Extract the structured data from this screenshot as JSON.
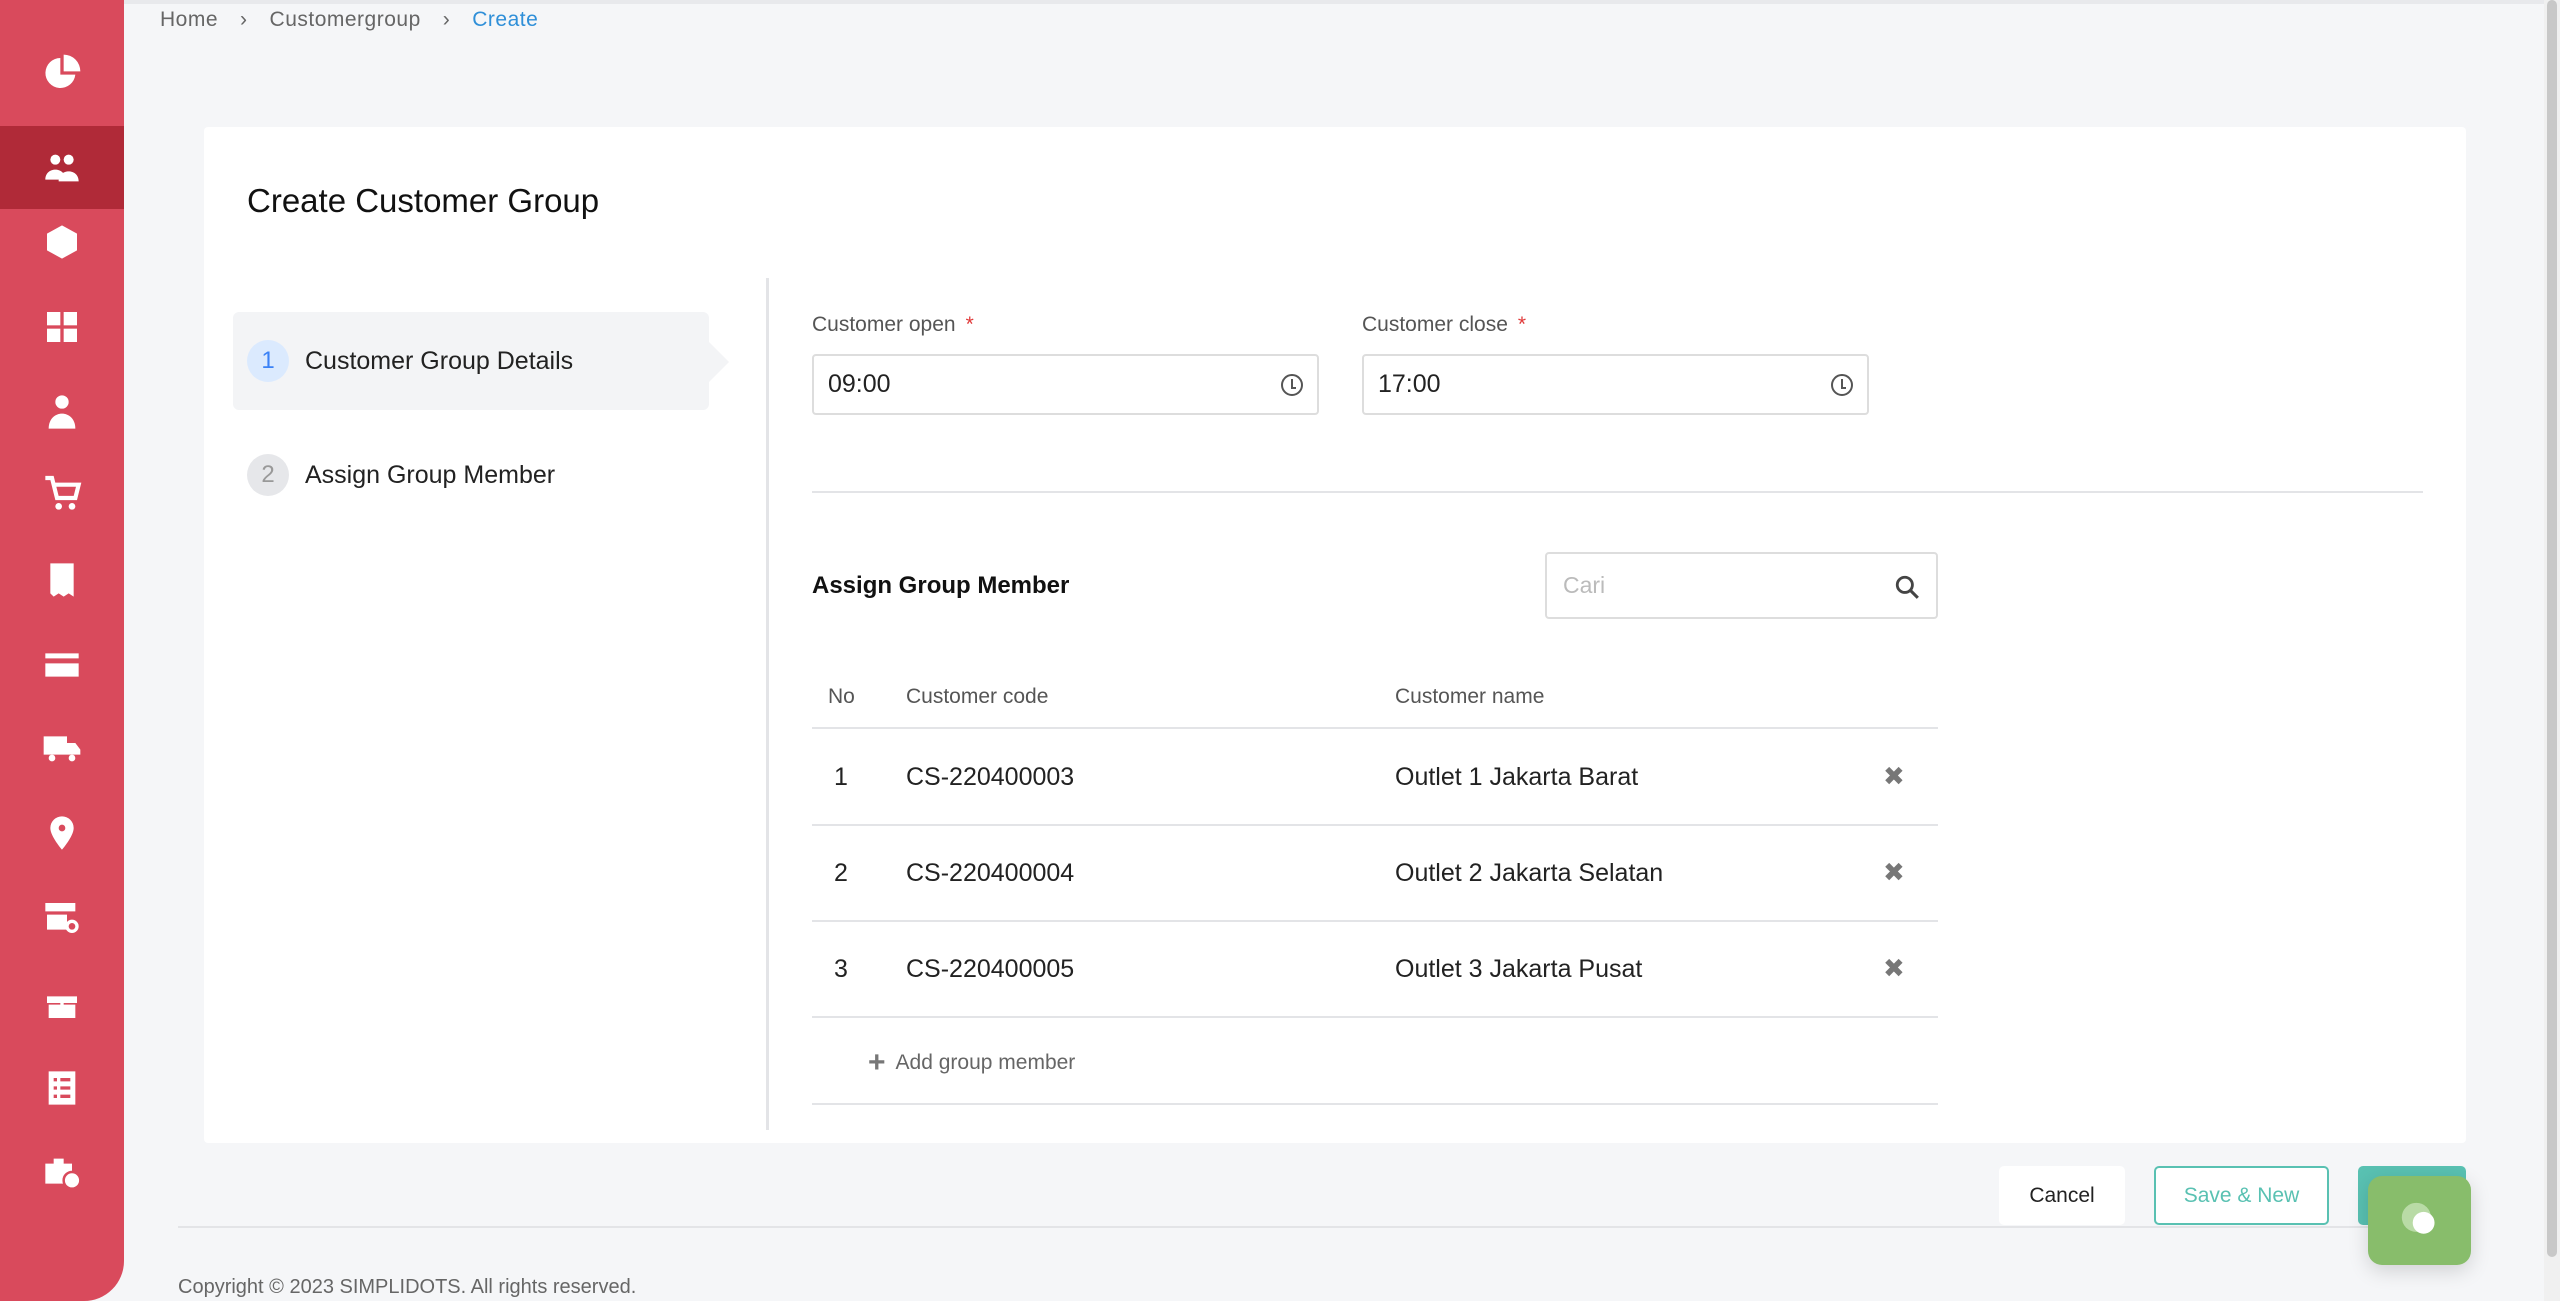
{
  "sidebar": {
    "accent": "#d94a5c",
    "active_color": "#b02a38",
    "items": [
      {
        "icon": "pie-chart-icon"
      },
      {
        "icon": "users-icon",
        "active": true
      },
      {
        "icon": "box-icon"
      },
      {
        "icon": "warehouse-boxes-icon"
      },
      {
        "icon": "salesman-icon"
      },
      {
        "icon": "cart-icon"
      },
      {
        "icon": "receipt-icon"
      },
      {
        "icon": "credit-card-icon"
      },
      {
        "icon": "truck-icon"
      },
      {
        "icon": "map-pin-icon"
      },
      {
        "icon": "store-search-icon"
      },
      {
        "icon": "gift-icon"
      },
      {
        "icon": "checklist-icon"
      },
      {
        "icon": "briefcase-clock-icon"
      }
    ]
  },
  "breadcrumb": {
    "home": "Home",
    "parent": "Customergroup",
    "current": "Create"
  },
  "page": {
    "title": "Create Customer Group"
  },
  "steps": [
    {
      "number": "1",
      "label": "Customer Group Details"
    },
    {
      "number": "2",
      "label": "Assign Group Member"
    }
  ],
  "form": {
    "open_label": "Customer open",
    "close_label": "Customer close",
    "required_mark": "*",
    "open_value": "09:00",
    "close_value": "17:00"
  },
  "members": {
    "title": "Assign Group Member",
    "search_placeholder": "Cari",
    "columns": {
      "no": "No",
      "code": "Customer code",
      "name": "Customer name"
    },
    "rows": [
      {
        "no": "1",
        "code": "CS-220400003",
        "name": "Outlet 1 Jakarta Barat"
      },
      {
        "no": "2",
        "code": "CS-220400004",
        "name": "Outlet 2 Jakarta Selatan"
      },
      {
        "no": "3",
        "code": "CS-220400005",
        "name": "Outlet 3 Jakarta Pusat"
      }
    ],
    "add_label": "Add group member"
  },
  "actions": {
    "cancel": "Cancel",
    "save_new": "Save & New",
    "primary_color": "#59c1b2"
  },
  "footer": {
    "copyright": "Copyright © 2023 SIMPLIDOTS. All rights reserved."
  }
}
